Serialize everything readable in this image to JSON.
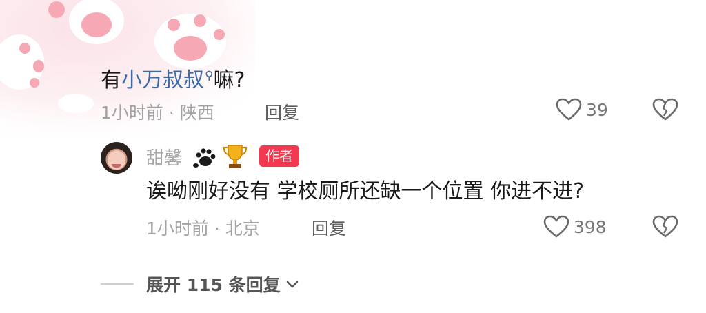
{
  "comment": {
    "text_before": "有",
    "mention": "小万叔叔",
    "mention_icon": "search-icon",
    "text_after": "嘛?",
    "meta": "1小时前 · 陕西",
    "reply_label": "回复",
    "like_count": "39"
  },
  "reply": {
    "username": "甜馨",
    "badges": [
      "paw-icon",
      "trophy-icon"
    ],
    "author_tag": "作者",
    "text": "诶呦刚好没有 学校厕所还缺一个位置 你进不进?",
    "meta": "1小时前 · 北京",
    "reply_label": "回复",
    "like_count": "398"
  },
  "expand": {
    "label": "展开 115 条回复"
  },
  "colors": {
    "accent_link": "#3d6aa8",
    "author_tag_bg": "#f2394f",
    "background_pink": "#fde6ea"
  }
}
